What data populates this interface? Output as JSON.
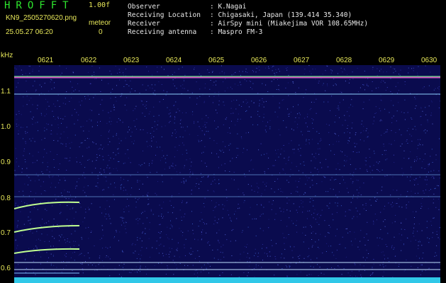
{
  "header": {
    "app_name": "HROFFT",
    "version": "1.00f",
    "filename": "KN9_2505270620.png",
    "timestamp": "25.05.27 06:20",
    "meteor_label": "meteor",
    "meteor_count": "0"
  },
  "info": [
    {
      "key": "Observer",
      "value": ": K.Nagai"
    },
    {
      "key": "Receiving Location",
      "value": ": Chigasaki, Japan (139.414 35.340)"
    },
    {
      "key": "Receiver",
      "value": ": AirSpy mini (Miakejima VOR 108.65MHz)"
    },
    {
      "key": "Receiving antenna",
      "value": ": Maspro FM-3"
    }
  ],
  "plot": {
    "y_unit": "kHz",
    "x_ticks": [
      "0621",
      "0622",
      "0623",
      "0624",
      "0625",
      "0626",
      "0627",
      "0628",
      "0629",
      "0630"
    ],
    "y_ticks": [
      "1.1",
      "1.0",
      "0.9",
      "0.8",
      "0.7",
      "0.6"
    ],
    "colors": {
      "background": "#000000",
      "plot_bg": "#0a0b4e",
      "label": "#e8e85a",
      "title": "#2ee62e"
    }
  }
}
